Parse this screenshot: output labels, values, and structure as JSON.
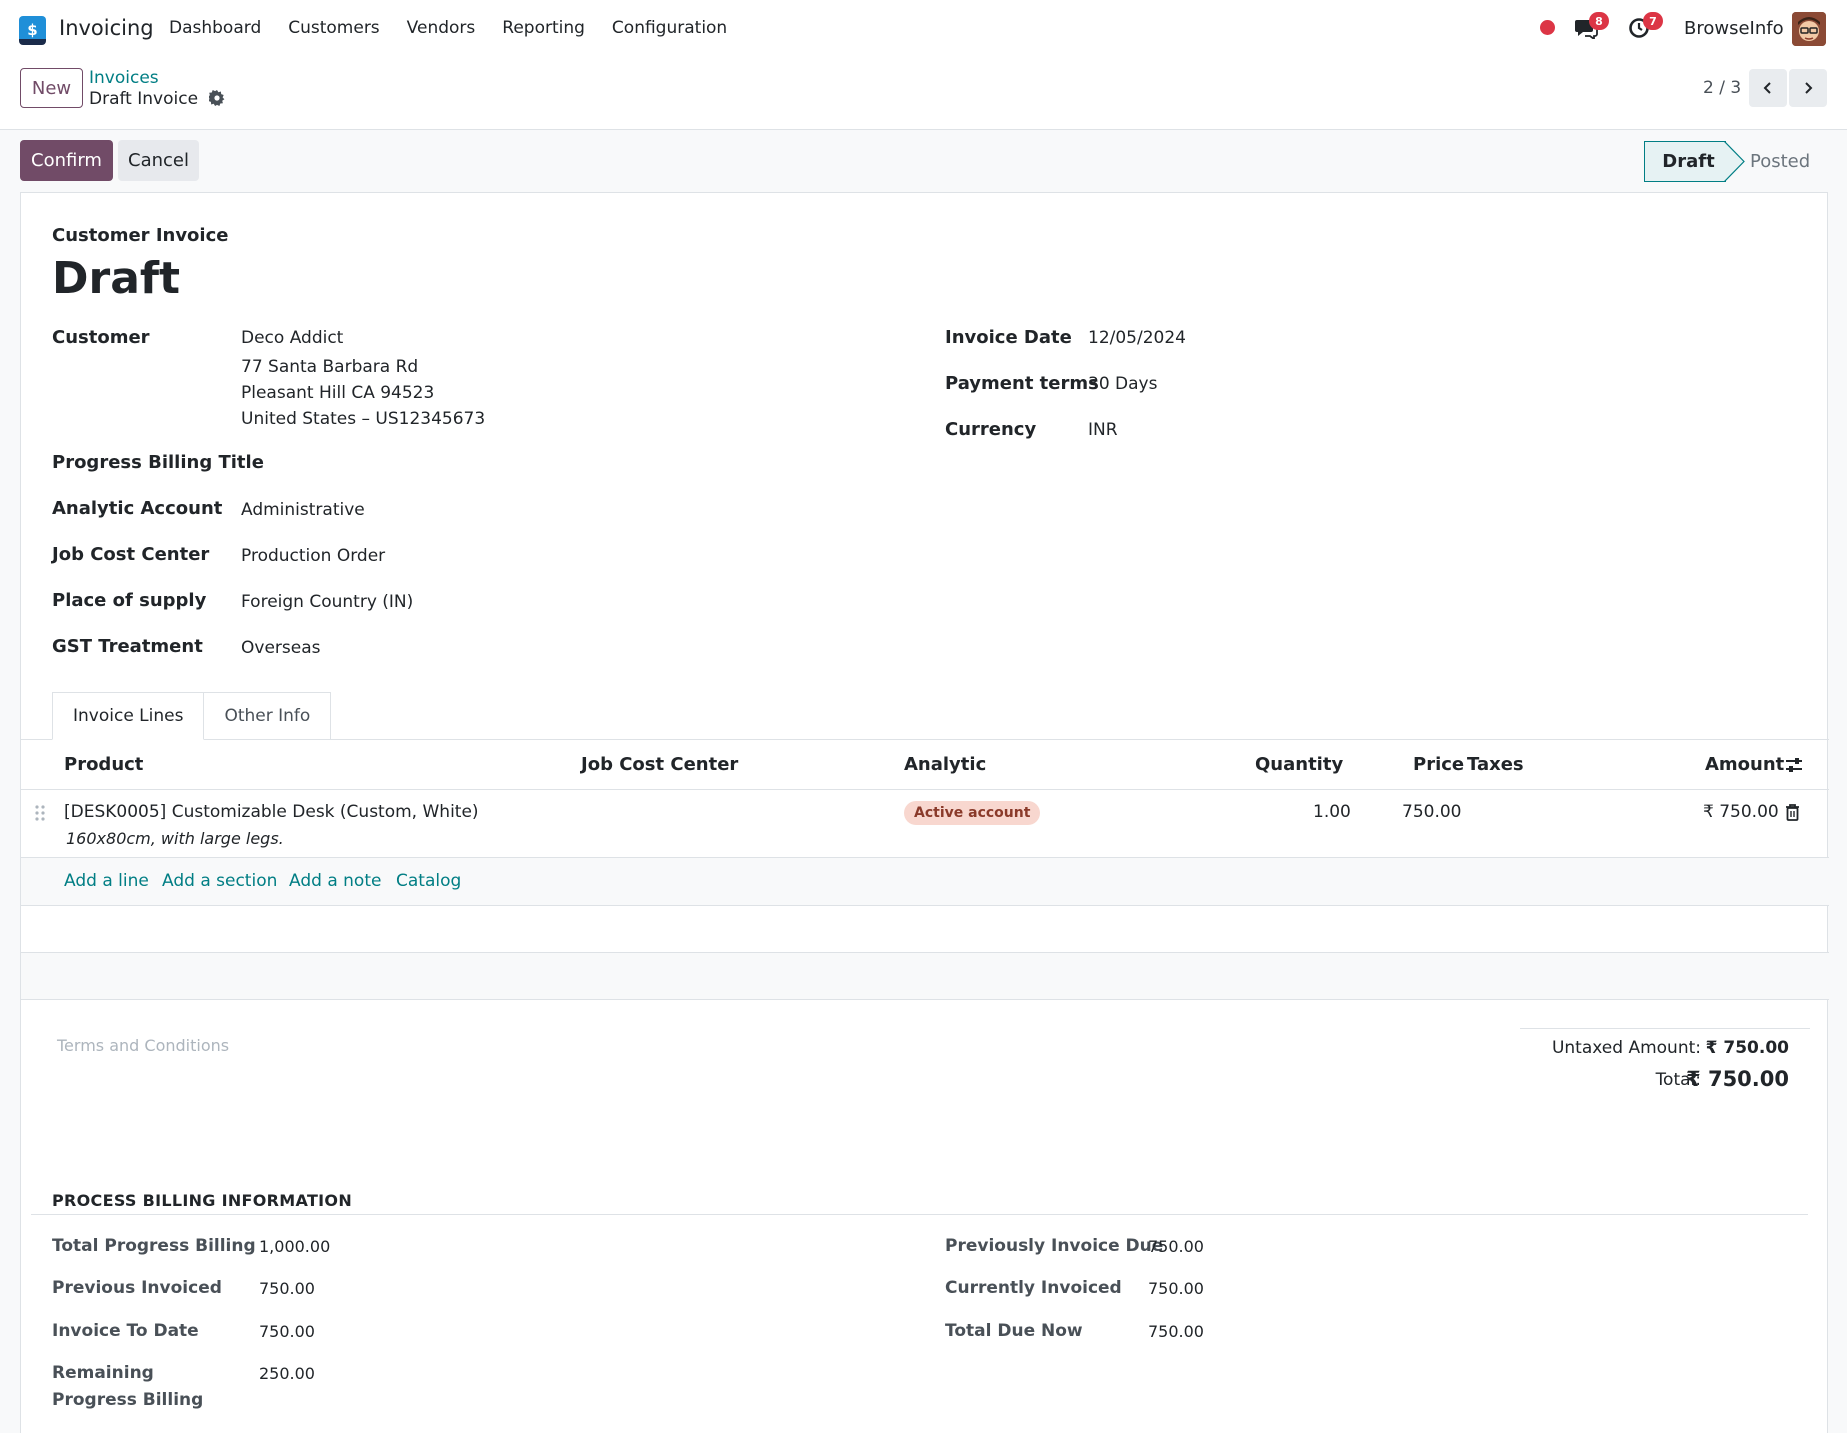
{
  "navbar": {
    "app_name": "Invoicing",
    "menu": [
      "Dashboard",
      "Customers",
      "Vendors",
      "Reporting",
      "Configuration"
    ],
    "messages_badge": "8",
    "activities_badge": "7",
    "user_name": "BrowseInfo",
    "logo_glyph": "$"
  },
  "control": {
    "new_label": "New",
    "breadcrumb_parent": "Invoices",
    "breadcrumb_current": "Draft Invoice",
    "pager": "2 / 3"
  },
  "actions": {
    "confirm_label": "Confirm",
    "cancel_label": "Cancel"
  },
  "status": {
    "stages": [
      "Draft",
      "Posted"
    ],
    "current": "Draft"
  },
  "form": {
    "doc_type": "Customer Invoice",
    "title": "Draft",
    "left_fields": {
      "customer_label": "Customer",
      "customer_name": "Deco Addict",
      "customer_addr1": "77 Santa Barbara Rd",
      "customer_addr2": "Pleasant Hill CA 94523",
      "customer_addr3": "United States – US12345673",
      "progress_title_label": "Progress Billing Title",
      "analytic_label": "Analytic Account",
      "analytic_value": "Administrative",
      "jobcost_label": "Job Cost Center",
      "jobcost_value": "Production Order",
      "supply_label": "Place of supply",
      "supply_value": "Foreign Country (IN)",
      "gst_label": "GST Treatment",
      "gst_value": "Overseas"
    },
    "right_fields": {
      "invoice_date_label": "Invoice Date",
      "invoice_date_value": "12/05/2024",
      "payment_terms_label": "Payment terms",
      "payment_terms_value": "30 Days",
      "currency_label": "Currency",
      "currency_value": "INR"
    }
  },
  "tabs": [
    "Invoice Lines",
    "Other Info"
  ],
  "lines_table": {
    "columns": [
      "Product",
      "Job Cost Center",
      "Analytic",
      "Quantity",
      "Price",
      "Taxes",
      "Amount"
    ],
    "rows": [
      {
        "product": "[DESK0005] Customizable Desk (Custom, White)",
        "description": "160x80cm, with large legs.",
        "job_cost_center": "",
        "analytic": "Active account",
        "quantity": "1.00",
        "price": "750.00",
        "taxes": "",
        "amount": "₹ 750.00"
      }
    ],
    "add_links": [
      "Add a line",
      "Add a section",
      "Add a note",
      "Catalog"
    ]
  },
  "terms_placeholder": "Terms and Conditions",
  "totals": {
    "untaxed_label": "Untaxed Amount:",
    "untaxed_value": "₹ 750.00",
    "total_label": "Total:",
    "total_value": "₹ 750.00"
  },
  "billing": {
    "section_title": "PROCESS BILLING INFORMATION",
    "left": [
      {
        "label": "Total Progress Billing",
        "value": "1,000.00"
      },
      {
        "label": "Previous Invoiced",
        "value": "750.00"
      },
      {
        "label": "Invoice To Date",
        "value": "750.00"
      },
      {
        "label": "Remaining Progress Billing",
        "value": "250.00"
      }
    ],
    "right": [
      {
        "label": "Previously Invoice Due",
        "value": "750.00"
      },
      {
        "label": "Currently Invoiced",
        "value": "750.00"
      },
      {
        "label": "Total Due Now",
        "value": "750.00"
      }
    ]
  },
  "colors": {
    "primary": "#714b67",
    "link": "#017e84",
    "badge": "#dc3545"
  }
}
